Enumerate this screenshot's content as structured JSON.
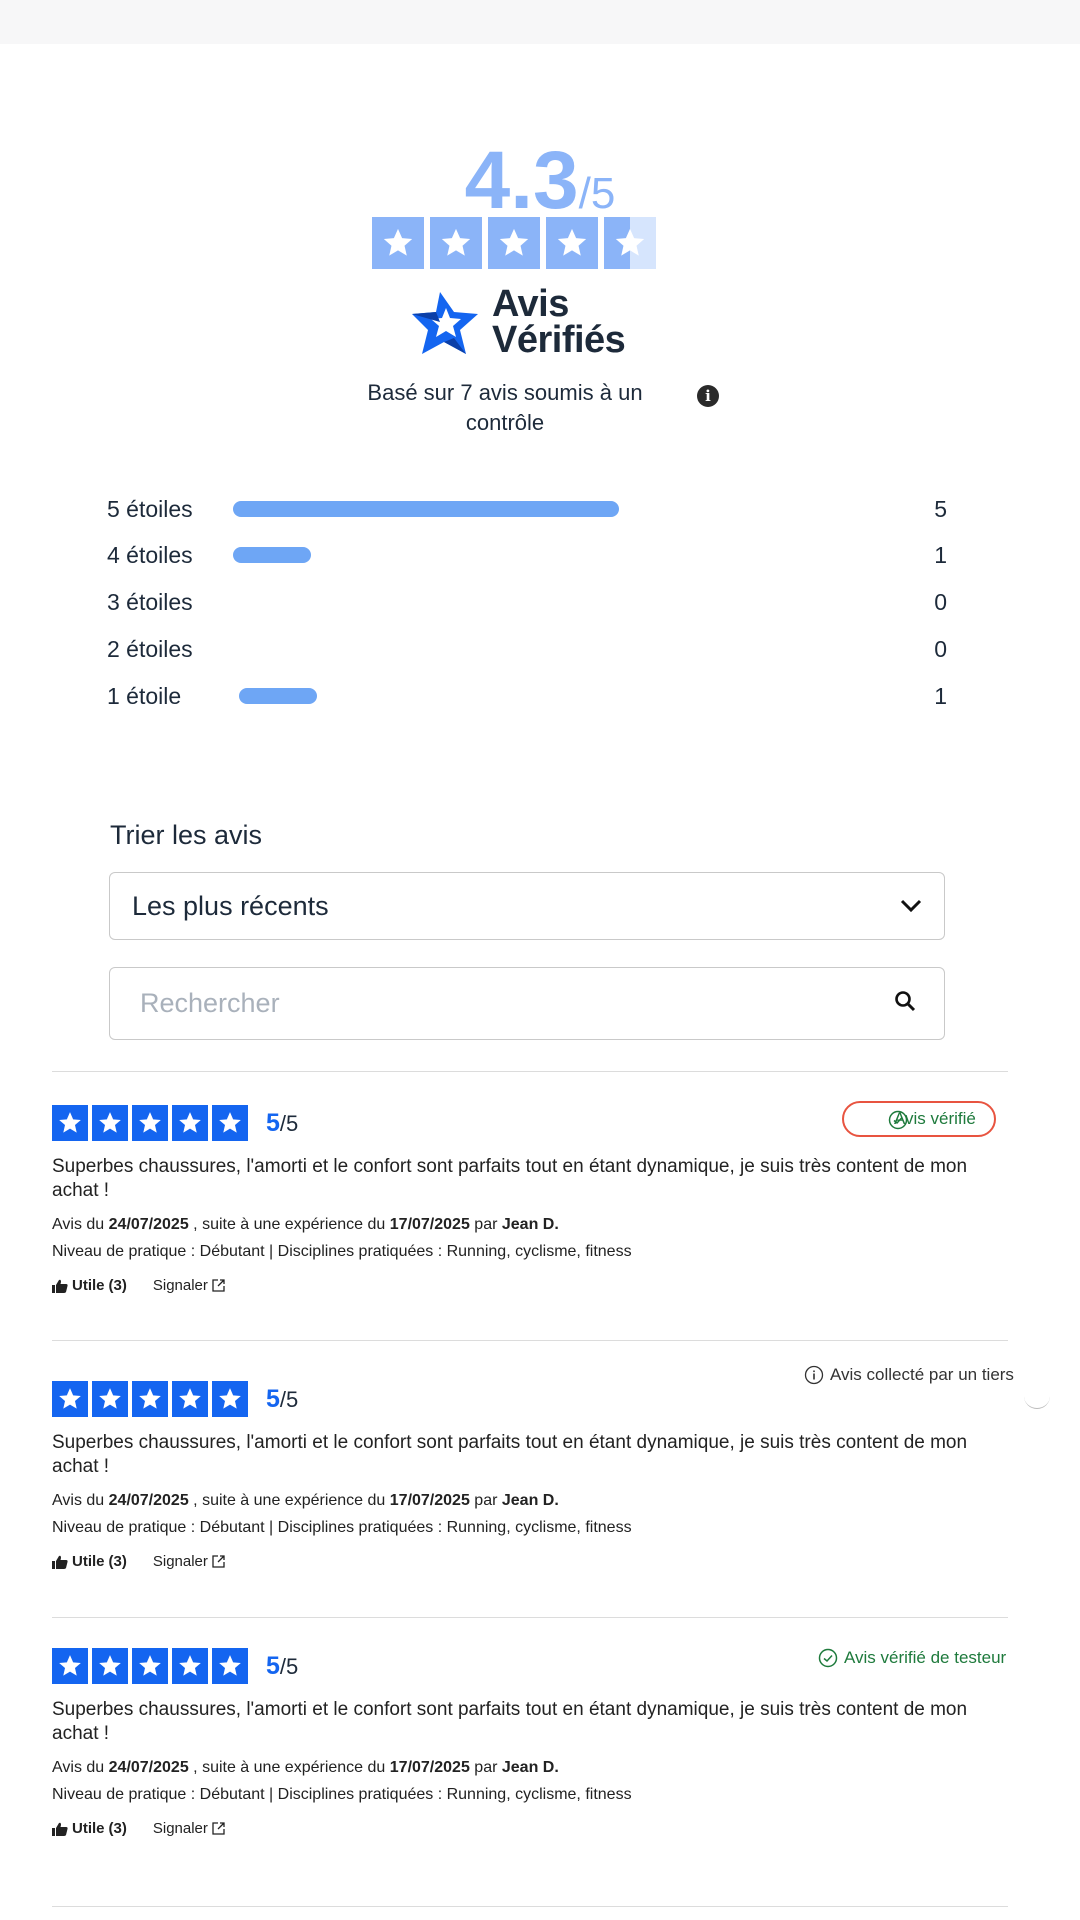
{
  "summary": {
    "score": "4.3",
    "score_den": "/5",
    "rating_value": 4.3,
    "rating_max": 5,
    "brand_line1": "Avis",
    "brand_line2": "Vérifiés",
    "basis_text": "Basé sur 7 avis soumis à un contrôle",
    "star_color": "#8bb4f8"
  },
  "distribution": {
    "bar_color": "#6ea6f5",
    "rows": [
      {
        "label": "5 étoiles",
        "count": "5",
        "fraction": 0.69
      },
      {
        "label": "4 étoiles",
        "count": "1",
        "fraction": 0.14
      },
      {
        "label": "3 étoiles",
        "count": "0",
        "fraction": 0
      },
      {
        "label": "2 étoiles",
        "count": "0",
        "fraction": 0
      },
      {
        "label": "1 étoile",
        "count": "1",
        "fraction": 0.14
      }
    ]
  },
  "sort": {
    "title": "Trier les avis",
    "selected": "Les plus récents",
    "search_placeholder": "Rechercher"
  },
  "reviews": [
    {
      "score": "5",
      "score_den": "/5",
      "badge": "Avis vérifié",
      "badge_icon": "check-circle-icon",
      "text": "Superbes chaussures, l'amorti et le confort sont parfaits tout en étant dynamique, je suis très content de mon achat !",
      "meta_prefix": "Avis du",
      "date": "24/07/2025",
      "meta_mid": ", suite à une expérience du",
      "experience_date": "17/07/2025",
      "meta_by": "par",
      "author": "Jean D.",
      "practice": "Niveau de pratique : Débutant | Disciplines pratiquées : Running, cyclisme, fitness",
      "useful_label": "Utile",
      "useful_count": "(3)",
      "report_label": "Signaler"
    },
    {
      "score": "5",
      "score_den": "/5",
      "badge": "Avis collecté par un tiers",
      "badge_icon": "info-circle-icon",
      "text": "Superbes chaussures, l'amorti et le confort sont parfaits tout en étant dynamique, je suis très content de mon achat !",
      "meta_prefix": "Avis du",
      "date": "24/07/2025",
      "meta_mid": ", suite à une expérience du",
      "experience_date": "17/07/2025",
      "meta_by": "par",
      "author": "Jean D.",
      "practice": "Niveau de pratique : Débutant | Disciplines pratiquées : Running, cyclisme, fitness",
      "useful_label": "Utile",
      "useful_count": "(3)",
      "report_label": "Signaler"
    },
    {
      "score": "5",
      "score_den": "/5",
      "badge": "Avis vérifié de testeur",
      "badge_icon": "check-circle-icon",
      "text": "Superbes chaussures, l'amorti et le confort sont parfaits tout en étant dynamique, je suis très content de mon achat !",
      "meta_prefix": "Avis du",
      "date": "24/07/2025",
      "meta_mid": ", suite à une expérience du",
      "experience_date": "17/07/2025",
      "meta_by": "par",
      "author": "Jean D.",
      "practice": "Niveau de pratique : Débutant | Disciplines pratiquées : Running, cyclisme, fitness",
      "useful_label": "Utile",
      "useful_count": "(3)",
      "report_label": "Signaler"
    }
  ],
  "colors": {
    "review_star": "#1465f0",
    "verified_green": "#1e7a3c",
    "highlight_red": "#e85440"
  }
}
